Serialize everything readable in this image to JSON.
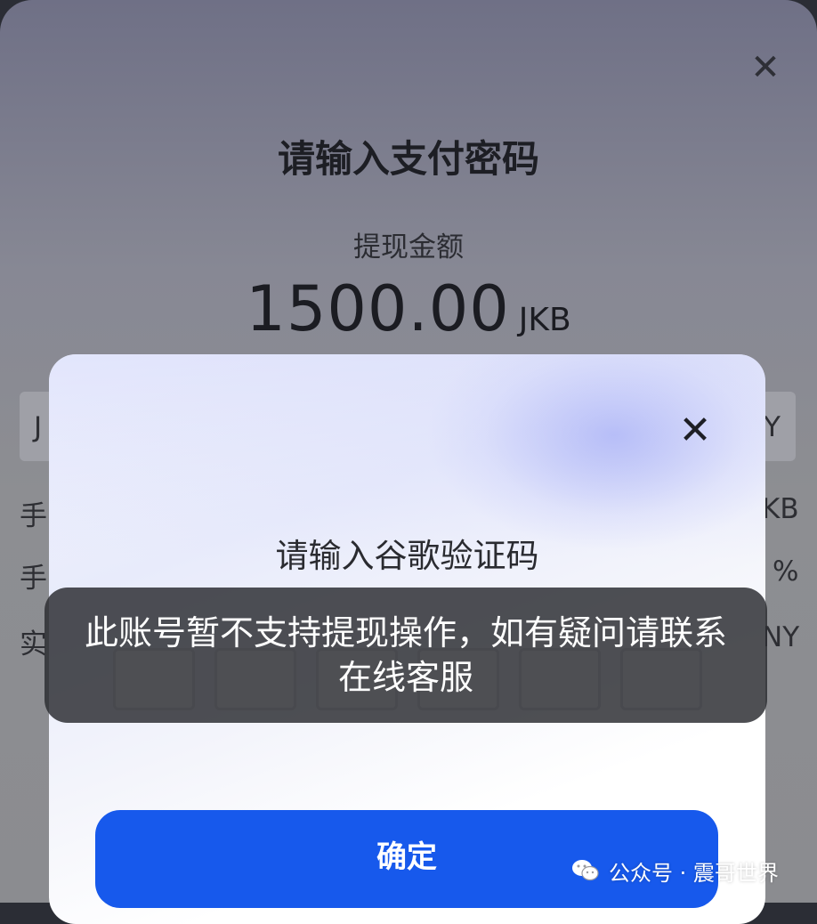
{
  "back_dialog": {
    "title": "请输入支付密码",
    "amount_label": "提现金额",
    "amount_value": "1500.00",
    "amount_unit": "JKB",
    "bar_left": "J",
    "bar_right": "Y",
    "row1_left": "手",
    "row1_right": "KB",
    "row2_left": "手",
    "row2_right": "%",
    "row3_left": "实",
    "row3_right": "NY"
  },
  "front_dialog": {
    "title": "请输入谷歌验证码",
    "confirm_label": "确定"
  },
  "toast": {
    "message": "此账号暂不支持提现操作，如有疑问请联系在线客服"
  },
  "watermark": {
    "text": "公众号 · 震哥世界"
  },
  "colors": {
    "confirm_button": "#1759ec",
    "toast_background": "#2c2d32"
  },
  "icons": {
    "back_close": "close-icon",
    "front_close": "close-icon",
    "watermark": "wechat-icon"
  }
}
